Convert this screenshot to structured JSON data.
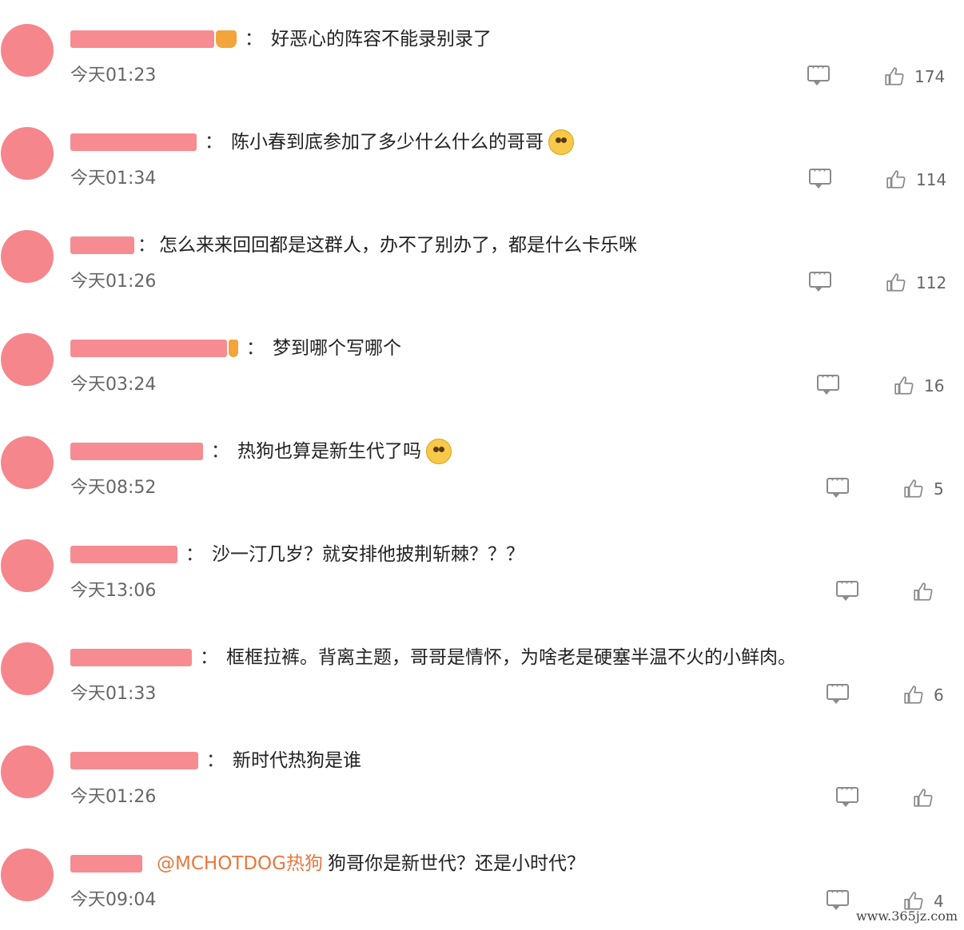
{
  "comments": [
    {
      "time": "今天01:23",
      "text": "好恶心的阵容不能录别录了",
      "likes": "174"
    },
    {
      "time": "今天01:34",
      "text": "陈小春到底参加了多少什么什么的哥哥",
      "likes": "114",
      "emoji": "dizzy-face-emoji"
    },
    {
      "time": "今天01:26",
      "text": "怎么来来回回都是这群人，办不了别办了，都是什么卡乐咪",
      "likes": "112"
    },
    {
      "time": "今天03:24",
      "text": "梦到哪个写哪个",
      "likes": "16"
    },
    {
      "time": "今天08:52",
      "text": "热狗也算是新生代了吗",
      "likes": "5",
      "emoji": "laughing-tears-emoji"
    },
    {
      "time": "今天13:06",
      "text": "沙一汀几岁？就安排他披荆斩棘？？？",
      "likes": ""
    },
    {
      "time": "今天01:33",
      "text": "框框拉裤。背离主题，哥哥是情怀，为啥老是硬塞半温不火的小鲜肉。",
      "likes": "6"
    },
    {
      "time": "今天01:26",
      "text": "新时代热狗是谁",
      "likes": ""
    },
    {
      "time": "今天09:04",
      "mention": "@MCHOTDOG热狗",
      "text": "狗哥你是新世代？还是小时代？",
      "likes": "4"
    }
  ],
  "colors": {
    "avatar": "#f5868c",
    "mention": "#e8783e",
    "icon": "#8a8a8a"
  },
  "watermark": "www.365jz.com"
}
